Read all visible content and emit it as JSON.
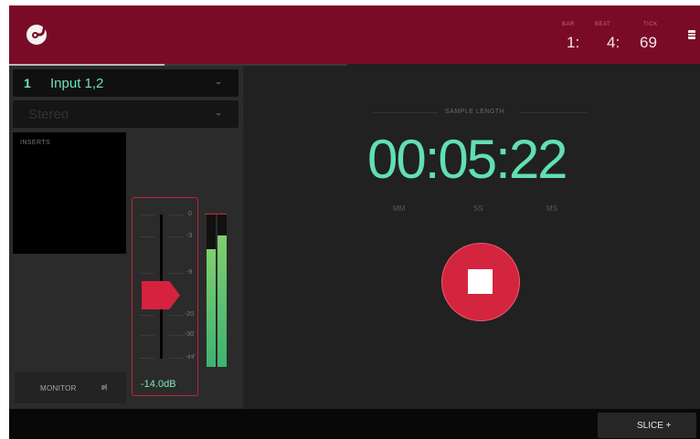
{
  "header": {
    "bar_label": "BAR",
    "beat_label": "BEAT",
    "tick_label": "TICK",
    "bar": "1:",
    "beat": "4:",
    "tick": "69"
  },
  "record_progress": 0.46,
  "input": {
    "channel": "1",
    "name": "Input 1,2",
    "mode": "Stereo"
  },
  "inserts_label": "INSERTS",
  "monitor_label": "MONITOR",
  "fader": {
    "scale": [
      "0",
      "-3",
      "-9",
      "-20",
      "-30",
      "-inf"
    ],
    "readout": "-14.0dB"
  },
  "meters": {
    "left_level": 0.77,
    "right_level": 0.86,
    "peak_hold": 0.97
  },
  "sample_length": {
    "label": "SAMPLE LENGTH",
    "time": "00:05:22",
    "units": [
      "MM",
      "SS",
      "MS"
    ]
  },
  "stop_button": {
    "state": "recording"
  },
  "bottom_bar": {
    "slice_label": "SLICE +"
  },
  "colors": {
    "header": "#7a0b26",
    "accent_green": "#62dfb1",
    "record_red": "#d3253e"
  }
}
